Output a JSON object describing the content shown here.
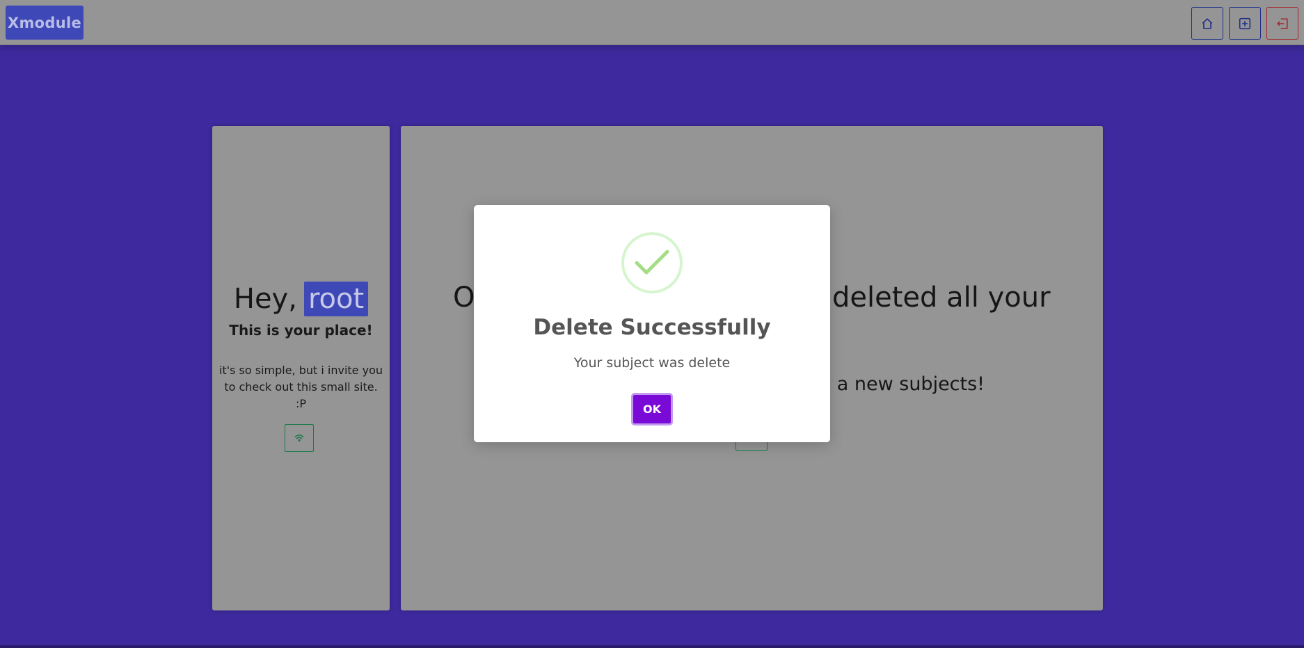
{
  "navbar": {
    "brand": "Xmodule",
    "buttons": [
      {
        "icon": "home-icon",
        "color": "#1d2f8a"
      },
      {
        "icon": "plus-square-icon",
        "color": "#1d2f8a"
      },
      {
        "icon": "logout-icon",
        "color": "#a3262c"
      }
    ]
  },
  "left_card": {
    "greeting": "Hey,",
    "username": "root",
    "subtitle": "This is your place!",
    "description": "it's so simple, but i invite you to check out this small site. :P",
    "button_icon": "wifi-icon"
  },
  "right_card": {
    "title_start": "O",
    "title_end": "deleted all your",
    "subtitle_end": "ea a new subjects!"
  },
  "modal": {
    "icon": "check-icon",
    "title": "Delete Successfully",
    "text": "Your subject was delete",
    "ok_label": "OK"
  },
  "colors": {
    "background": "#3e2a9e",
    "brand": "#3e48b7",
    "ok_button": "#7a0bd6",
    "success": "#a5dc86"
  }
}
